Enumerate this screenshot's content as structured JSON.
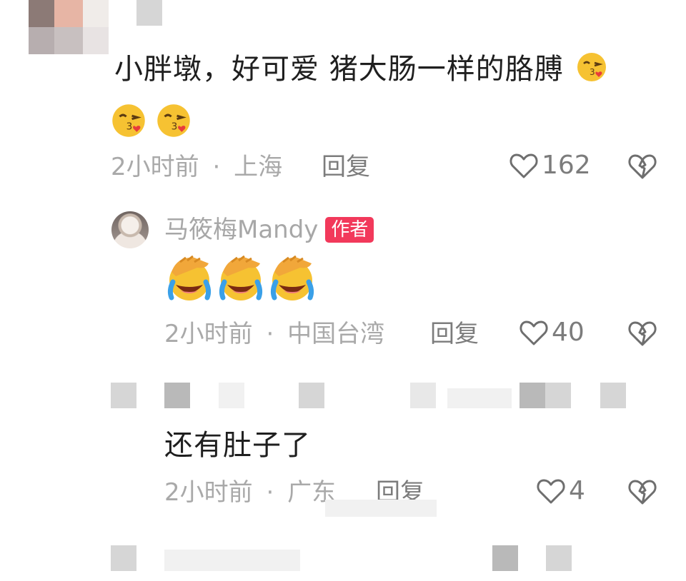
{
  "comments": [
    {
      "text": "小胖墩，好可爱 猪大肠一样的胳膊",
      "emojis": [
        "kissing-face-with-heart",
        "kissing-face-with-heart",
        "kissing-face-with-heart"
      ],
      "time": "2小时前",
      "separator": "·",
      "location": "上海",
      "reply_label": "回复",
      "likes": "162"
    },
    {
      "username": "马筱梅Mandy",
      "badge": "作者",
      "emojis": [
        "face-palm-crying-laughing",
        "face-palm-crying-laughing",
        "face-palm-crying-laughing"
      ],
      "time": "2小时前",
      "separator": "·",
      "location": "中国台湾",
      "reply_label": "回复",
      "likes": "40"
    },
    {
      "text": "还有肚子了",
      "time": "2小时前",
      "separator": "·",
      "location": "广东",
      "reply_label": "回复",
      "likes": "4"
    }
  ],
  "colors": {
    "text": "#1f1f1f",
    "meta": "#a9a9a9",
    "action": "#7c7c7c",
    "badge": "#f2395b",
    "icon": "#6e6e6e"
  },
  "icons": [
    "heart-icon",
    "broken-heart-icon"
  ]
}
